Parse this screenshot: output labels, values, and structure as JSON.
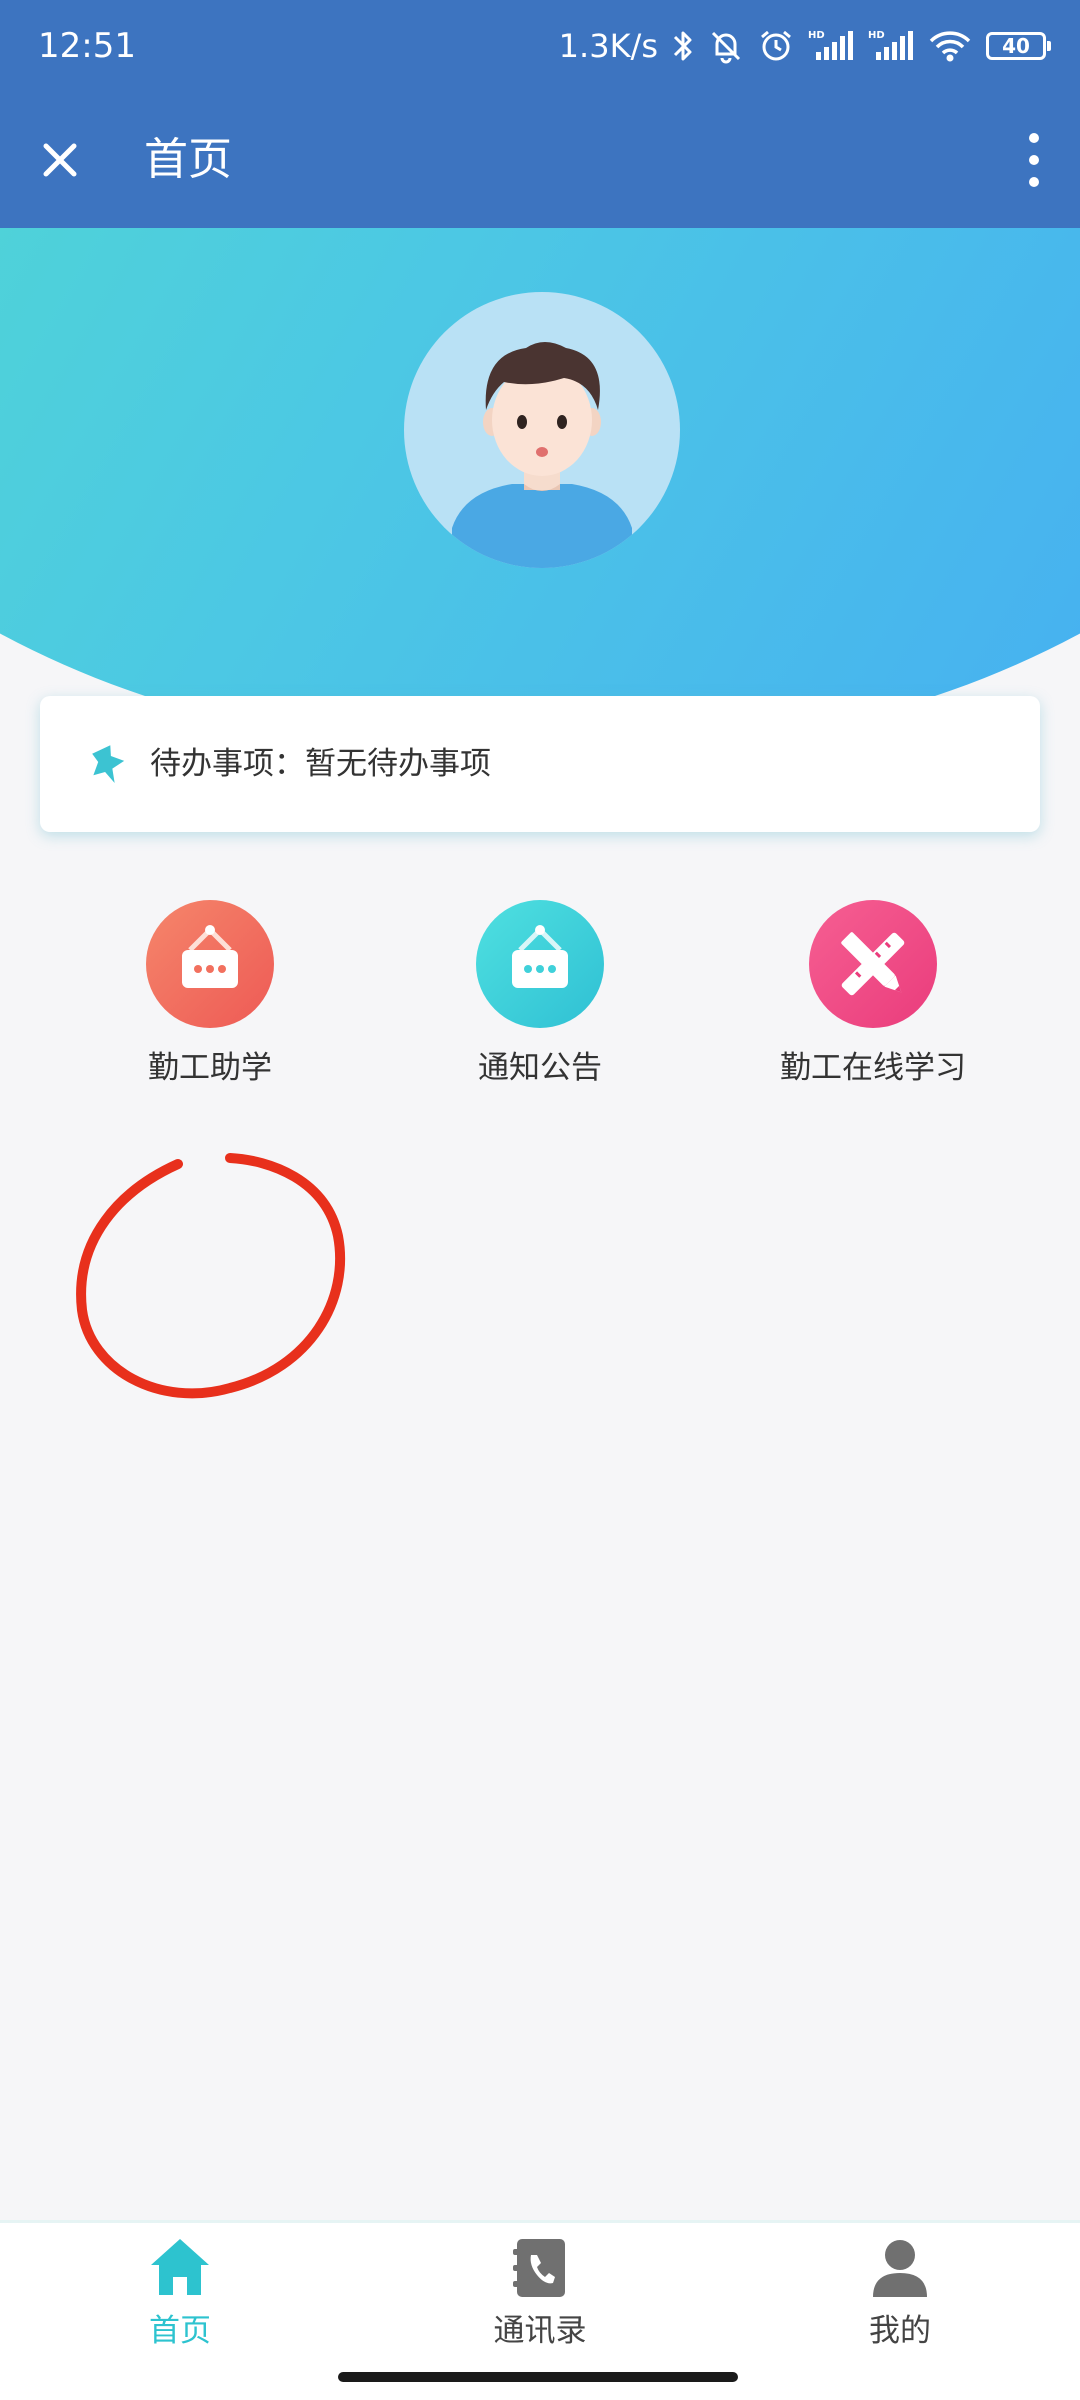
{
  "status_bar": {
    "time": "12:51",
    "net_speed": "1.3K/s",
    "icons": [
      "bluetooth-icon",
      "bell-muted-icon",
      "alarm-icon",
      "hd-signal-icon",
      "hd-signal-icon",
      "wifi-icon"
    ],
    "battery": "40"
  },
  "title_bar": {
    "title": "首页",
    "close_icon": "close-icon",
    "more_icon": "more-vertical-icon"
  },
  "hero": {
    "avatar": "user-avatar",
    "gradient_colors": [
      "#52dccd",
      "#4cc8e4",
      "#45aaf4"
    ]
  },
  "todo": {
    "icon": "pin-icon",
    "text": "待办事项：暂无待办事项"
  },
  "grid": [
    {
      "label": "勤工助学",
      "icon": "sign-board-icon",
      "color": "#f2705e"
    },
    {
      "label": "通知公告",
      "icon": "sign-board-icon",
      "color": "#3fd1da"
    },
    {
      "label": "勤工在线学习",
      "icon": "pencil-ruler-icon",
      "color": "#f04d88"
    }
  ],
  "tabs": [
    {
      "label": "首页",
      "icon": "home-icon",
      "active": true
    },
    {
      "label": "通讯录",
      "icon": "contacts-book-icon",
      "active": false
    },
    {
      "label": "我的",
      "icon": "person-icon",
      "active": false
    }
  ],
  "colors": {
    "header": "#3d74c0",
    "accent": "#2dc3cf",
    "annotation": "#e8301c"
  }
}
